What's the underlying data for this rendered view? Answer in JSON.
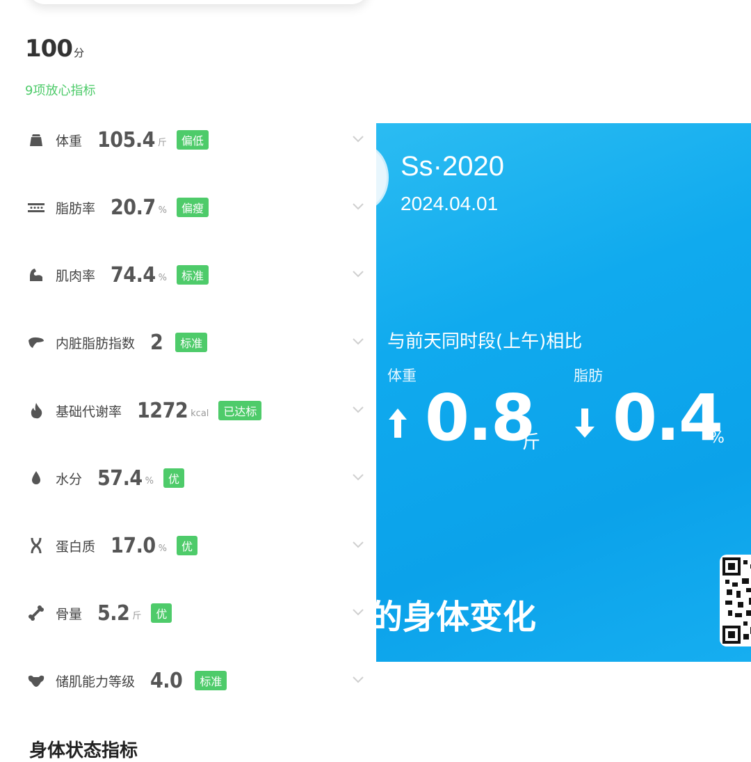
{
  "score": {
    "value": "100",
    "unit": "分"
  },
  "subtitle": "9项放心指标",
  "metrics": [
    {
      "icon": "weight-icon",
      "label": "体重",
      "value": "105.4",
      "unit": "斤",
      "badge": "偏低"
    },
    {
      "icon": "body-fat-icon",
      "label": "脂肪率",
      "value": "20.7",
      "unit": "%",
      "badge": "偏瘦"
    },
    {
      "icon": "muscle-icon",
      "label": "肌肉率",
      "value": "74.4",
      "unit": "%",
      "badge": "标准"
    },
    {
      "icon": "visceral-fat-icon",
      "label": "内脏脂肪指数",
      "value": "2",
      "unit": "",
      "badge": "标准"
    },
    {
      "icon": "flame-icon",
      "label": "基础代谢率",
      "value": "1272",
      "unit": "kcal",
      "badge": "已达标"
    },
    {
      "icon": "water-drop-icon",
      "label": "水分",
      "value": "57.4",
      "unit": "%",
      "badge": "优"
    },
    {
      "icon": "protein-dna-icon",
      "label": "蛋白质",
      "value": "17.0",
      "unit": "%",
      "badge": "优"
    },
    {
      "icon": "bone-icon",
      "label": "骨量",
      "value": "5.2",
      "unit": "斤",
      "badge": "优"
    },
    {
      "icon": "muscle-storage-icon",
      "label": "储肌能力等级",
      "value": "4.0",
      "unit": "",
      "badge": "标准"
    }
  ],
  "section_title": "身体状态指标",
  "card": {
    "user": "Ss·2020",
    "date": "2024.04.01",
    "compare_title": "与前天同时段(上午)相比",
    "weight_label": "体重",
    "weight_value": "0.8",
    "weight_unit": "斤",
    "weight_direction": "up",
    "fat_label": "脂肪",
    "fat_value": "0.4",
    "fat_unit": "%",
    "fat_direction": "down",
    "footer_text": "的身体变化"
  },
  "colors": {
    "accent_green": "#4ecb6a",
    "card_blue": "#10aaee"
  }
}
